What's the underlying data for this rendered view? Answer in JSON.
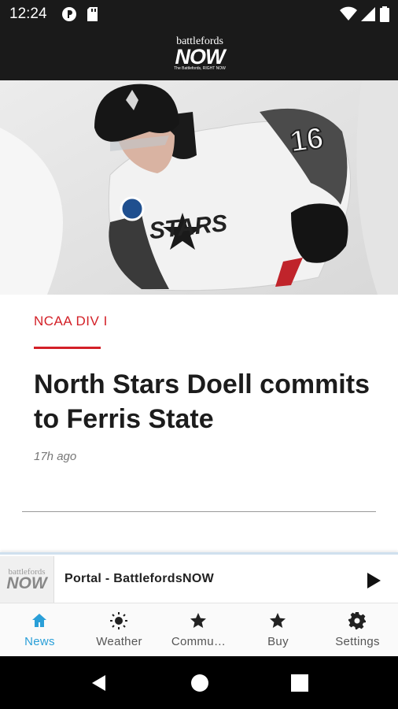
{
  "status_bar": {
    "time": "12:24"
  },
  "app_bar": {
    "logo_top": "battlefords",
    "logo_main": "NOW",
    "logo_tagline": "The Battlefords, RIGHT NOW"
  },
  "article": {
    "category": "NCAA DIV I",
    "headline": "North Stars Doell commits to Ferris State",
    "time_ago": "17h ago",
    "image": {
      "jersey_text": "STARS",
      "jersey_number": "16"
    }
  },
  "player": {
    "title": "Portal - BattlefordsNOW",
    "thumb_top": "battlefords",
    "thumb_main": "NOW"
  },
  "bottom_nav": [
    {
      "label": "News",
      "icon": "home-icon"
    },
    {
      "label": "Weather",
      "icon": "sun-icon"
    },
    {
      "label": "Commu…",
      "icon": "star-icon"
    },
    {
      "label": "Buy",
      "icon": "star-icon"
    },
    {
      "label": "Settings",
      "icon": "gear-icon"
    }
  ],
  "colors": {
    "accent_red": "#d32027",
    "active_blue": "#2a9fd8",
    "bar_dark": "#1a1a1a"
  }
}
